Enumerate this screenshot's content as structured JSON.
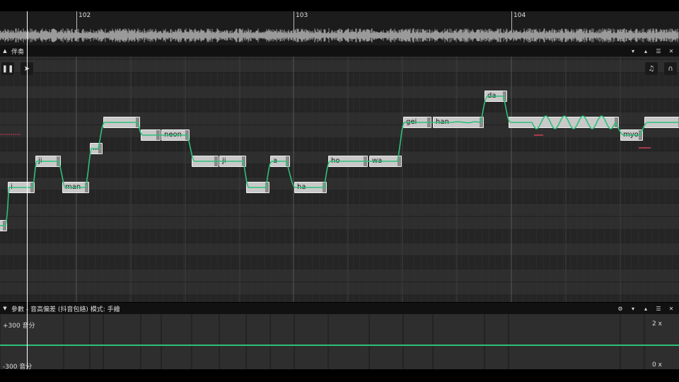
{
  "timeline": {
    "bars": [
      {
        "label": "102"
      },
      {
        "label": "103"
      },
      {
        "label": "104"
      }
    ]
  },
  "accompaniment": {
    "title": "伴奏",
    "collapse_icon": "▲",
    "controls": [
      "▾",
      "▴",
      "☰",
      "✕"
    ]
  },
  "toolbar": {
    "pause_label": "❚❚",
    "pointer_label": "➤",
    "note_tool_label": "♫",
    "headphone_label": "∩"
  },
  "notes": [
    {
      "lyric": ""
    },
    {
      "lyric": "i"
    },
    {
      "lyric": "ji"
    },
    {
      "lyric": "man"
    },
    {
      "lyric": "..."
    },
    {
      "lyric": ""
    },
    {
      "lyric": ""
    },
    {
      "lyric": "neon"
    },
    {
      "lyric": ""
    },
    {
      "lyric": "ji"
    },
    {
      "lyric": ""
    },
    {
      "lyric": "a"
    },
    {
      "lyric": "ha"
    },
    {
      "lyric": "ho"
    },
    {
      "lyric": "wa"
    },
    {
      "lyric": "gei"
    },
    {
      "lyric": "han"
    },
    {
      "lyric": "da"
    },
    {
      "lyric": ""
    },
    {
      "lyric": "myo"
    },
    {
      "lyric": ""
    }
  ],
  "params": {
    "collapse_icon": "▼",
    "title": "參數 - 音高偏差 (抖音包絡) 模式: 手繪",
    "controls": [
      "⚙",
      "▾",
      "▴",
      "☰",
      "✕"
    ],
    "top_label": "+300 音分",
    "bottom_label": "-300 音分",
    "top_scale": "2 x",
    "bottom_scale": "0 x"
  },
  "colors": {
    "pitch_curve": "#2fbf7a",
    "note_fill": "#c9c9c9",
    "playhead": "#ffffff",
    "marker_red": "#d0405a"
  }
}
